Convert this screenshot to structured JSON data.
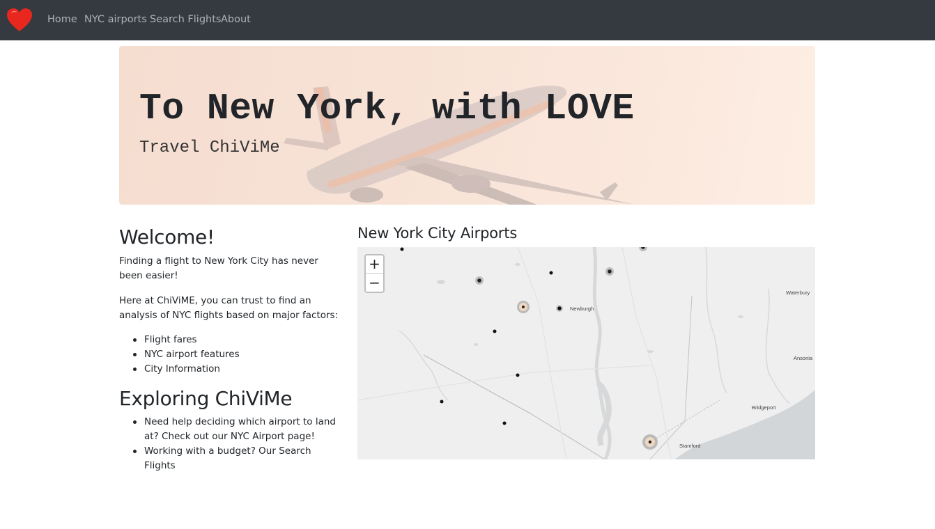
{
  "navbar": {
    "brand_icon": "heart-icon",
    "brand_color": "#e8271e",
    "links": [
      "Home",
      "NYC airports",
      "Search Flights",
      "About"
    ]
  },
  "jumbotron": {
    "title": "To New York, with LOVE",
    "subtitle": "Travel ChiViMe"
  },
  "welcome": {
    "heading": "Welcome!",
    "para1": "Finding a flight to New York City has never been easier!",
    "para2": "Here at ChiViME, you can trust to find an analysis of NYC flights based on major factors:",
    "factors": [
      "Flight fares",
      "NYC airport features",
      "City Information"
    ]
  },
  "exploring": {
    "heading": "Exploring ChiViMe",
    "items": [
      "Need help deciding which airport to land at? Check out our NYC Airport page!",
      "Working with a budget? Our Search Flights"
    ]
  },
  "map": {
    "heading": "New York City Airports",
    "zoom_in": "+",
    "zoom_out": "−",
    "labels": {
      "newburgh": "Newburgh",
      "waterbury": "Waterbury",
      "ansonia": "Ansonia",
      "bridgeport": "Bridgeport",
      "stamford": "Stamford"
    }
  }
}
